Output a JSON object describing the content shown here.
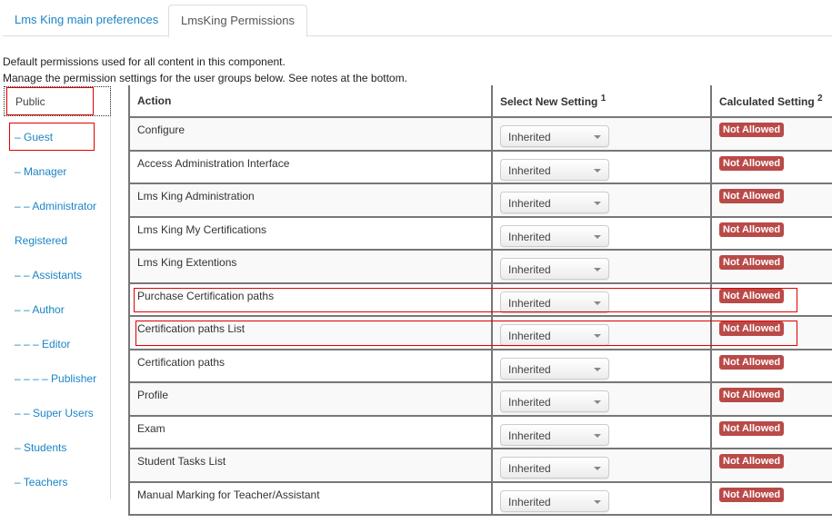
{
  "tabs": [
    {
      "label": "Lms King main preferences",
      "active": false
    },
    {
      "label": "LmsKing Permissions",
      "active": true
    }
  ],
  "description": {
    "line1": "Default permissions used for all content in this component.",
    "line2": "Manage the permission settings for the user groups below. See notes at the bottom."
  },
  "groups": [
    {
      "label": "Public",
      "active": true,
      "highlighted": true
    },
    {
      "label": "– Guest",
      "active": false,
      "highlighted": true
    },
    {
      "label": "– Manager",
      "active": false
    },
    {
      "label": "– – Administrator",
      "active": false
    },
    {
      "label": "Registered",
      "active": false
    },
    {
      "label": "– – Assistants",
      "active": false
    },
    {
      "label": "– – Author",
      "active": false
    },
    {
      "label": "– – – Editor",
      "active": false
    },
    {
      "label": "– – – – Publisher",
      "active": false
    },
    {
      "label": "– – Super Users",
      "active": false
    },
    {
      "label": "– Students",
      "active": false
    },
    {
      "label": "– Teachers",
      "active": false
    }
  ],
  "table": {
    "headers": {
      "action": "Action",
      "select": "Select New Setting",
      "select_note": "1",
      "calculated": "Calculated Setting",
      "calculated_note": "2"
    },
    "rows": [
      {
        "action": "Configure",
        "setting": "Inherited",
        "calculated": "Not Allowed"
      },
      {
        "action": "Access Administration Interface",
        "setting": "Inherited",
        "calculated": "Not Allowed"
      },
      {
        "action": "Lms King Administration",
        "setting": "Inherited",
        "calculated": "Not Allowed"
      },
      {
        "action": "Lms King My Certifications",
        "setting": "Inherited",
        "calculated": "Not Allowed"
      },
      {
        "action": "Lms King Extentions",
        "setting": "Inherited",
        "calculated": "Not Allowed"
      },
      {
        "action": "Purchase Certification paths",
        "setting": "Inherited",
        "calculated": "Not Allowed",
        "highlighted": true
      },
      {
        "action": "Certification paths List",
        "setting": "Inherited",
        "calculated": "Not Allowed",
        "highlighted": true
      },
      {
        "action": "Certification paths",
        "setting": "Inherited",
        "calculated": "Not Allowed"
      },
      {
        "action": "Profile",
        "setting": "Inherited",
        "calculated": "Not Allowed"
      },
      {
        "action": "Exam",
        "setting": "Inherited",
        "calculated": "Not Allowed"
      },
      {
        "action": "Student Tasks List",
        "setting": "Inherited",
        "calculated": "Not Allowed"
      },
      {
        "action": "Manual Marking for Teacher/Assistant",
        "setting": "Inherited",
        "calculated": "Not Allowed"
      }
    ]
  },
  "colors": {
    "link": "#1a85c6",
    "badge_not_allowed": "#b94a48",
    "highlight_box": "#e00000"
  }
}
